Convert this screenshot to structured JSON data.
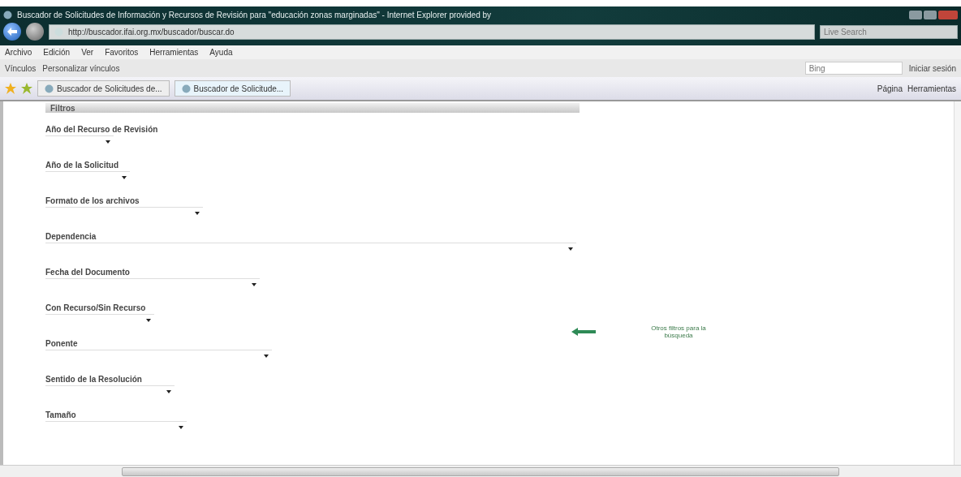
{
  "window": {
    "title": "Buscador de Solicitudes de Información y Recursos de Revisión para \"educación zonas marginadas\" - Internet Explorer provided by"
  },
  "address_bar": {
    "url": "http://buscador.ifai.org.mx/buscador/buscar.do"
  },
  "search": {
    "placeholder": "Live Search"
  },
  "menu": [
    "Archivo",
    "Edición",
    "Ver",
    "Favoritos",
    "Herramientas",
    "Ayuda"
  ],
  "links_bar": {
    "label": "Vínculos",
    "item": "Personalizar vínculos",
    "bing_placeholder": "Bing",
    "sign_in": "Iniciar sesión"
  },
  "tabs": [
    {
      "label": "Buscador de Solicitudes de...",
      "selected": false
    },
    {
      "label": "Buscador de Solicitude...",
      "selected": true
    }
  ],
  "command_bar": [
    "Página",
    "Herramientas"
  ],
  "filters": {
    "title": "Filtros",
    "fields": [
      {
        "label": "Año del Recurso de Revisión"
      },
      {
        "label": "Año de la Solicitud"
      },
      {
        "label": "Formato de los archivos"
      },
      {
        "label": "Dependencia"
      },
      {
        "label": "Fecha del Documento"
      },
      {
        "label": "Con Recurso/Sin Recurso"
      },
      {
        "label": "Ponente"
      },
      {
        "label": "Sentido de la Resolución"
      },
      {
        "label": "Tamaño"
      }
    ]
  },
  "note": "Otros filtros para la búsqueda"
}
